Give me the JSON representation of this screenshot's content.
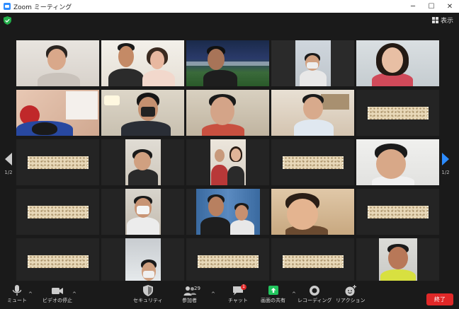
{
  "window": {
    "title": "Zoom ミーティング",
    "min": "─",
    "max": "☐",
    "close": "✕"
  },
  "topbar": {
    "view_label": "表示"
  },
  "pager": {
    "left": "1/2",
    "right": "1/2"
  },
  "toolbar": {
    "mute": "ミュート",
    "video": "ビデオの停止",
    "security": "セキュリティ",
    "participants": "参加者",
    "participants_count": "29",
    "chat": "チャット",
    "chat_badge": "1",
    "share": "画面の共有",
    "record": "レコーディング",
    "reactions": "リアクション",
    "end": "終了"
  },
  "colors": {
    "accent": "#2d8cff",
    "share_green": "#22c55e",
    "end_red": "#e02828",
    "speaker_outline": "#c8e03a"
  }
}
